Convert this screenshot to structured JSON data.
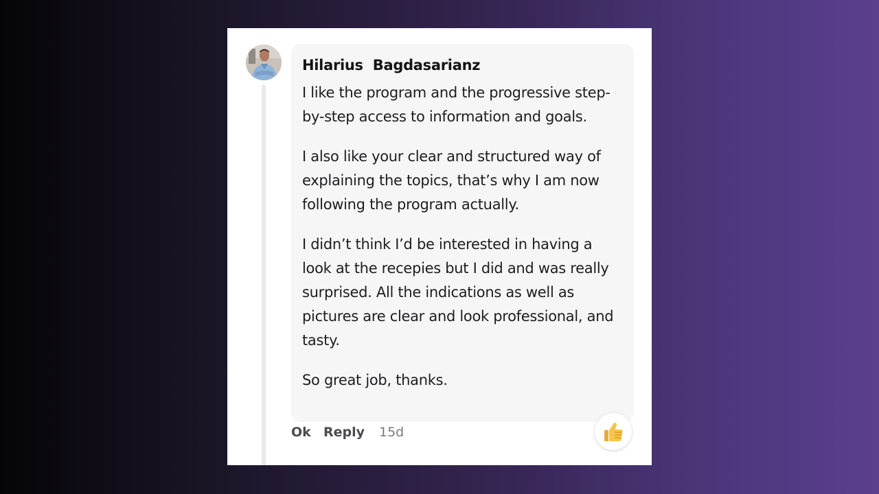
{
  "comment": {
    "author": "Hilarius  Bagdasarianz",
    "paragraphs": [
      "I like the program and the progressive step-by-step access to information and goals.",
      "I also like your clear and structured way of explaining the topics, that’s why I am now following the program actually.",
      "I didn’t think I’d be interested in having a look at the recepies but I did and was really surprised. All the indications as well as pictures are clear and look professional, and tasty.",
      "So great job, thanks."
    ],
    "timestamp": "15d"
  },
  "actions": {
    "ok_label": "Ok",
    "reply_label": "Reply"
  },
  "reaction": {
    "icon": "thumbs-up-icon",
    "color": "#f7c54a"
  },
  "colors": {
    "bubble_bg": "#f6f6f7",
    "card_bg": "#ffffff",
    "gradient_start": "#050507",
    "gradient_end": "#5b3f8f"
  }
}
